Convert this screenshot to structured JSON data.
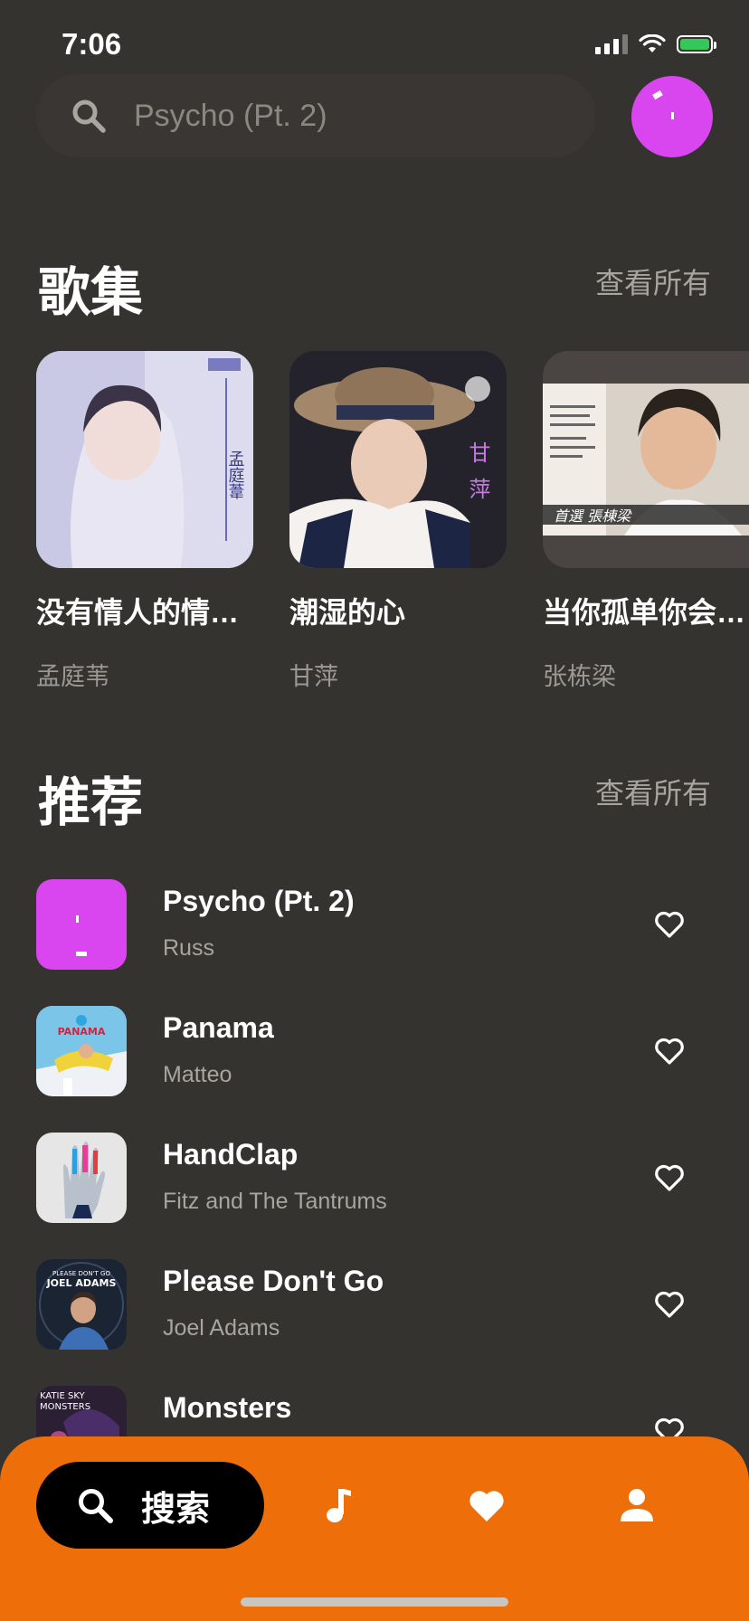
{
  "status_bar": {
    "time": "7:06"
  },
  "search": {
    "placeholder": "Psycho (Pt. 2)",
    "icon": "search-icon"
  },
  "albums_section": {
    "title": "歌集",
    "see_all": "查看所有",
    "items": [
      {
        "title": "没有情人的情…",
        "artist": "孟庭苇",
        "cover_color": "#d9d8ee"
      },
      {
        "title": "潮湿的心",
        "artist": "甘萍",
        "cover_color": "#2a2730"
      },
      {
        "title": "当你孤单你会…",
        "artist": "张栋梁",
        "cover_color": "#b8b2a6"
      }
    ]
  },
  "recommend_section": {
    "title": "推荐",
    "see_all": "查看所有",
    "items": [
      {
        "title": "Psycho (Pt. 2)",
        "artist": "Russ",
        "thumb_color": "#d946ef"
      },
      {
        "title": "Panama",
        "artist": "Matteo",
        "thumb_color": "#e9eef3"
      },
      {
        "title": "HandClap",
        "artist": "Fitz and The Tantrums",
        "thumb_color": "#dedede"
      },
      {
        "title": "Please Don't Go",
        "artist": "Joel Adams",
        "thumb_color": "#1f2b3a"
      },
      {
        "title": "Monsters",
        "artist": "",
        "thumb_color": "#2b1f3a"
      }
    ]
  },
  "bottom_nav": {
    "search_label": "搜索",
    "items": [
      "search-icon",
      "music-note-icon",
      "heart-icon",
      "person-icon"
    ],
    "color": "#ee6e0a"
  },
  "colors": {
    "background": "#353330",
    "accent": "#ee6e0a",
    "avatar": "#d946ef"
  }
}
